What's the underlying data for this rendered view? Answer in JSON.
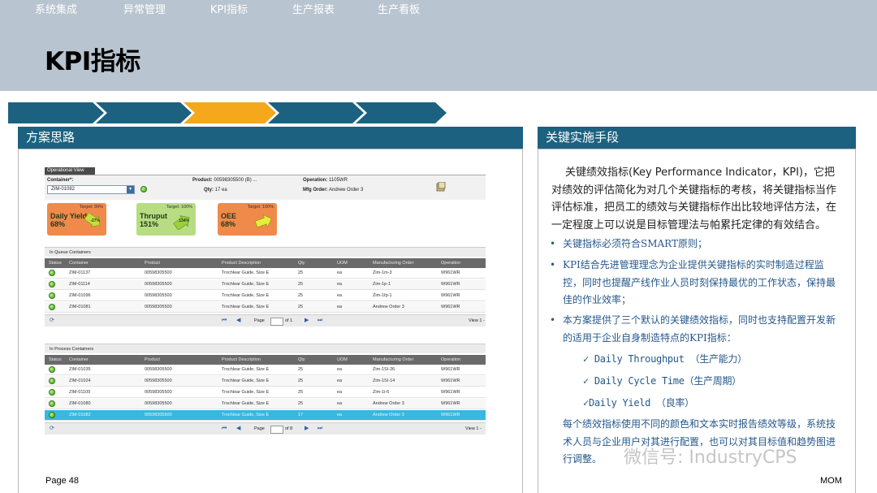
{
  "slide": {
    "title": "KPI指标",
    "page": "Page 48",
    "footer_right": "MOM",
    "watermark": "微信号: IndustryCPS"
  },
  "nav": {
    "items": [
      "系统集成",
      "异常管理",
      "KPI指标",
      "生产报表",
      "生产看板"
    ],
    "active_index": 2,
    "colors": {
      "normal": "#1c6280",
      "active": "#f5a81c"
    }
  },
  "left_panel": {
    "title": "方案思路"
  },
  "right_panel": {
    "title": "关键实施手段",
    "intro": "关键绩效指标(Key Performance Indicator，KPI)，它把对绩效的评估简化为对几个关键指标的考核，将关键指标当作评估标准，把员工的绩效与关键指标作出比较地评估方法，在一定程度上可以说是目标管理法与帕累托定律的有效结合。",
    "bullets": [
      "关键指标必须符合SMART原则；",
      "KPI结合先进管理理念为企业提供关键指标的实时制造过程监控，同时也提醒产线作业人员时刻保持最优的工作状态，保持最佳的作业效率；",
      "本方案提供了三个默认的关键绩效指标，同时也支持配置开发新的适用于企业自身制造特点的KPI指标："
    ],
    "checks": [
      "Daily Throughput （生产能力）",
      "Daily Cycle Time（生产周期）",
      "Daily Yield （良率）"
    ],
    "last_bullet": "每个绩效指标使用不同的颜色和文本实时报告绩效等级，系统技术人员与企业用户对其进行配置，也可以对其目标值和趋势图进行调整。"
  },
  "app": {
    "tab": "Operational View",
    "container_label": "Container*:",
    "container_value": "ZIM-01082",
    "product_label": "Product:",
    "product_value": "00598305500 (B) ...",
    "qty_label": "Qty:",
    "qty_value": "17 ea",
    "operation_label": "Operation:",
    "operation_value": "1105WR",
    "mfg_label": "Mfg Order:",
    "mfg_value": "Andrew Order 3",
    "kpis": [
      {
        "name": "Daily Yield",
        "value": "68%",
        "target": "Target: 99%",
        "pct": "-27%",
        "color": "#f08a4b"
      },
      {
        "name": "Thruput",
        "value": "151%",
        "target": "Target: 100%",
        "pct": "134%",
        "color": "#b8dc82"
      },
      {
        "name": "OEE",
        "value": "68%",
        "target": "Target: 100%",
        "pct": "",
        "color": "#f08a4b"
      }
    ],
    "columns": [
      "Status",
      "Container",
      "Product",
      "Product Description",
      "Qty",
      "UOM",
      "Manufacturing Order",
      "Operation"
    ],
    "queue": {
      "title": "In Queue Containers",
      "rows": [
        [
          "ZIM-01137",
          "00598305500",
          "Trochlear Guide, Size E",
          "25",
          "ea",
          "Zim-1m-3",
          "W961WR"
        ],
        [
          "ZIM-01114",
          "00598305500",
          "Trochlear Guide, Size E",
          "25",
          "ea",
          "Zim-1p-1",
          "W961WR"
        ],
        [
          "ZIM-01096",
          "00598305500",
          "Trochlear Guide, Size E",
          "25",
          "ea",
          "Zim-1fp-1",
          "W961WR"
        ],
        [
          "ZIM-01081",
          "00598305500",
          "Trochlear Guide, Size E",
          "25",
          "ea",
          "Andrew Order 3",
          "W961WR"
        ]
      ],
      "page_text": "Page",
      "page_of": "of 1",
      "view_text": "View 1 -"
    },
    "process": {
      "title": "In Process Containers",
      "rows": [
        [
          "ZIM-01035",
          "00598305500",
          "Trochlear Guide, Size E",
          "25",
          "ea",
          "Zim-1SI-26",
          "W961WR"
        ],
        [
          "ZIM-01024",
          "00598305500",
          "Trochlear Guide, Size E",
          "25",
          "ea",
          "Zim-1SI-14",
          "W961WR"
        ],
        [
          "ZIM-01109",
          "00598305500",
          "Trochlear Guide, Size E",
          "25",
          "ea",
          "Zim-1i-6",
          "W961WR"
        ],
        [
          "ZIM-01080",
          "00598305500",
          "Trochlear Guide, Size E",
          "25",
          "ea",
          "Andrew Order 3",
          "W961WR"
        ],
        [
          "ZIM-01082",
          "00598305500",
          "Trochlear Guide, Size E",
          "17",
          "ea",
          "Andrew Order 3",
          "W961WR"
        ]
      ],
      "highlight_index": 4,
      "page_text": "Page",
      "page_of": "of 8",
      "view_text": "View 1 -"
    }
  }
}
